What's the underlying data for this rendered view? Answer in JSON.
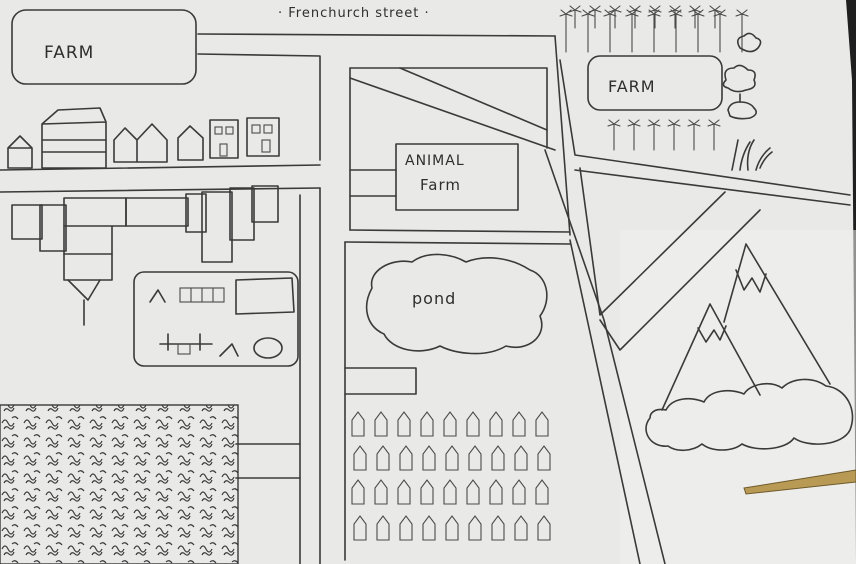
{
  "map": {
    "street_label": "· Frenchurch street ·",
    "farm_left_label": "FARM",
    "farm_right_label": "FARM",
    "animal_farm_line1": "ANIMAL",
    "animal_farm_line2": "Farm",
    "pond_label": "pond"
  },
  "colors": {
    "paper": "#e9e9e7",
    "ink": "#3a3a3a",
    "background": "#1f1f1f",
    "pencil": "#b89a55"
  }
}
